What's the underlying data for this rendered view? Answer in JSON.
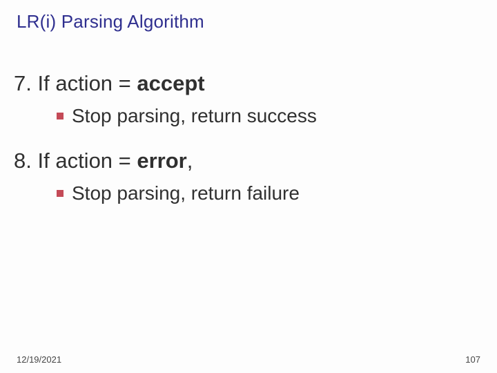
{
  "title": "LR(i) Parsing Algorithm",
  "steps": [
    {
      "num": "7.",
      "text_prefix": "If action = ",
      "keyword": "accept",
      "sub": "Stop parsing, return success"
    },
    {
      "num": "8.",
      "text_prefix": "If action = ",
      "keyword": "error",
      "trailing": ",",
      "sub": "Stop parsing, return failure"
    }
  ],
  "footer": {
    "date": "12/19/2021",
    "page": "107"
  }
}
